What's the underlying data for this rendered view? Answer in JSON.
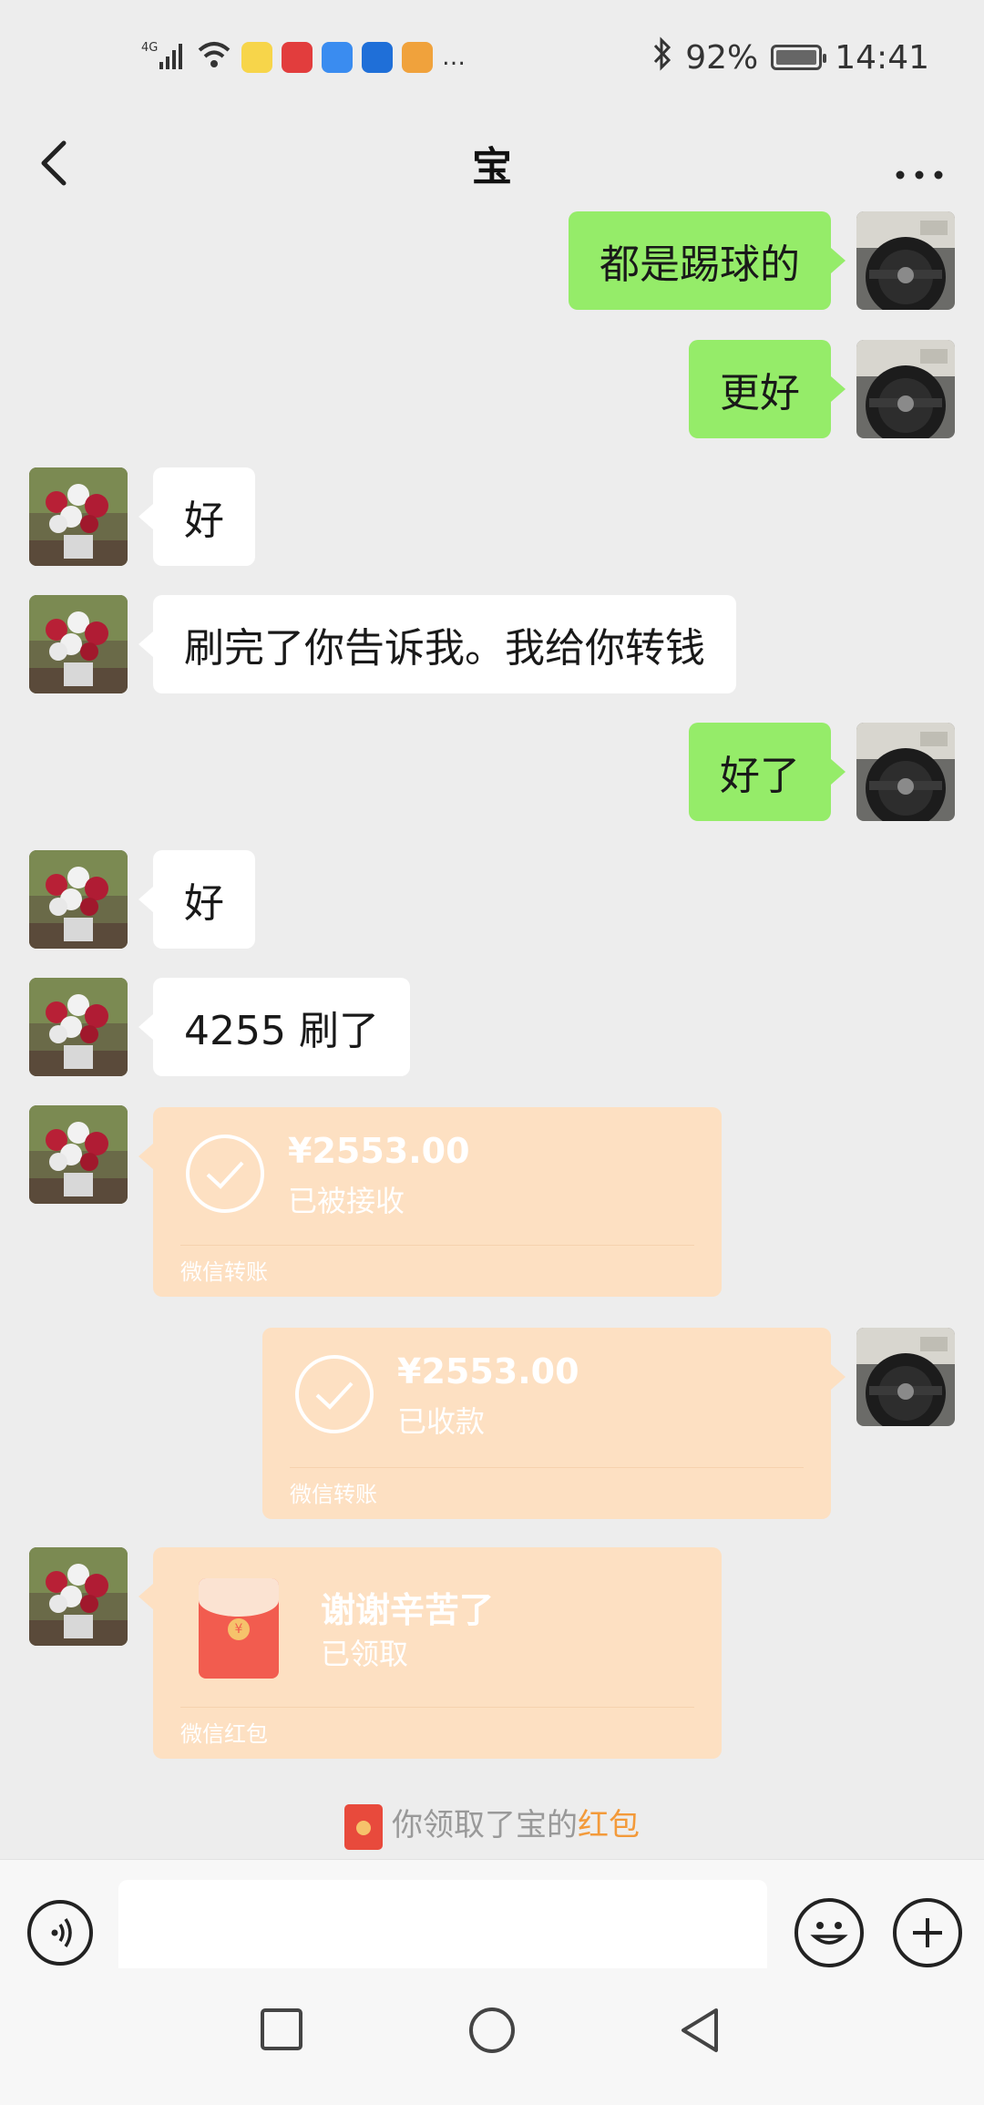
{
  "status_bar": {
    "network": "4G",
    "battery_percent": "92%",
    "time": "14:41",
    "more_notifications": "…"
  },
  "header": {
    "title": "宝",
    "back_icon": "chevron-left-icon",
    "more_icon": "more-dots-icon"
  },
  "messages": [
    {
      "from": "me",
      "text": "都是踢球的"
    },
    {
      "from": "me",
      "text": "更好"
    },
    {
      "from": "peer",
      "text": "好"
    },
    {
      "from": "peer",
      "text": "刷完了你告诉我。我给你转钱"
    },
    {
      "from": "me",
      "text": "好了"
    },
    {
      "from": "peer",
      "text": "好"
    },
    {
      "from": "peer",
      "text": "4255 刷了"
    }
  ],
  "transfer_in": {
    "amount": "¥2553.00",
    "status": "已被接收",
    "label": "微信转账"
  },
  "transfer_out": {
    "amount": "¥2553.00",
    "status": "已收款",
    "label": "微信转账"
  },
  "red_packet": {
    "message": "谢谢辛苦了",
    "status": "已领取",
    "label": "微信红包",
    "coin_symbol": "¥"
  },
  "system_note": {
    "prefix": "你领取了宝的",
    "highlight": "红包"
  },
  "input_bar": {
    "placeholder": ""
  },
  "colors": {
    "my_bubble": "#95ec69",
    "peer_bubble": "#ffffff",
    "transfer_card": "#fde0c2",
    "highlight": "#f39a3a"
  }
}
